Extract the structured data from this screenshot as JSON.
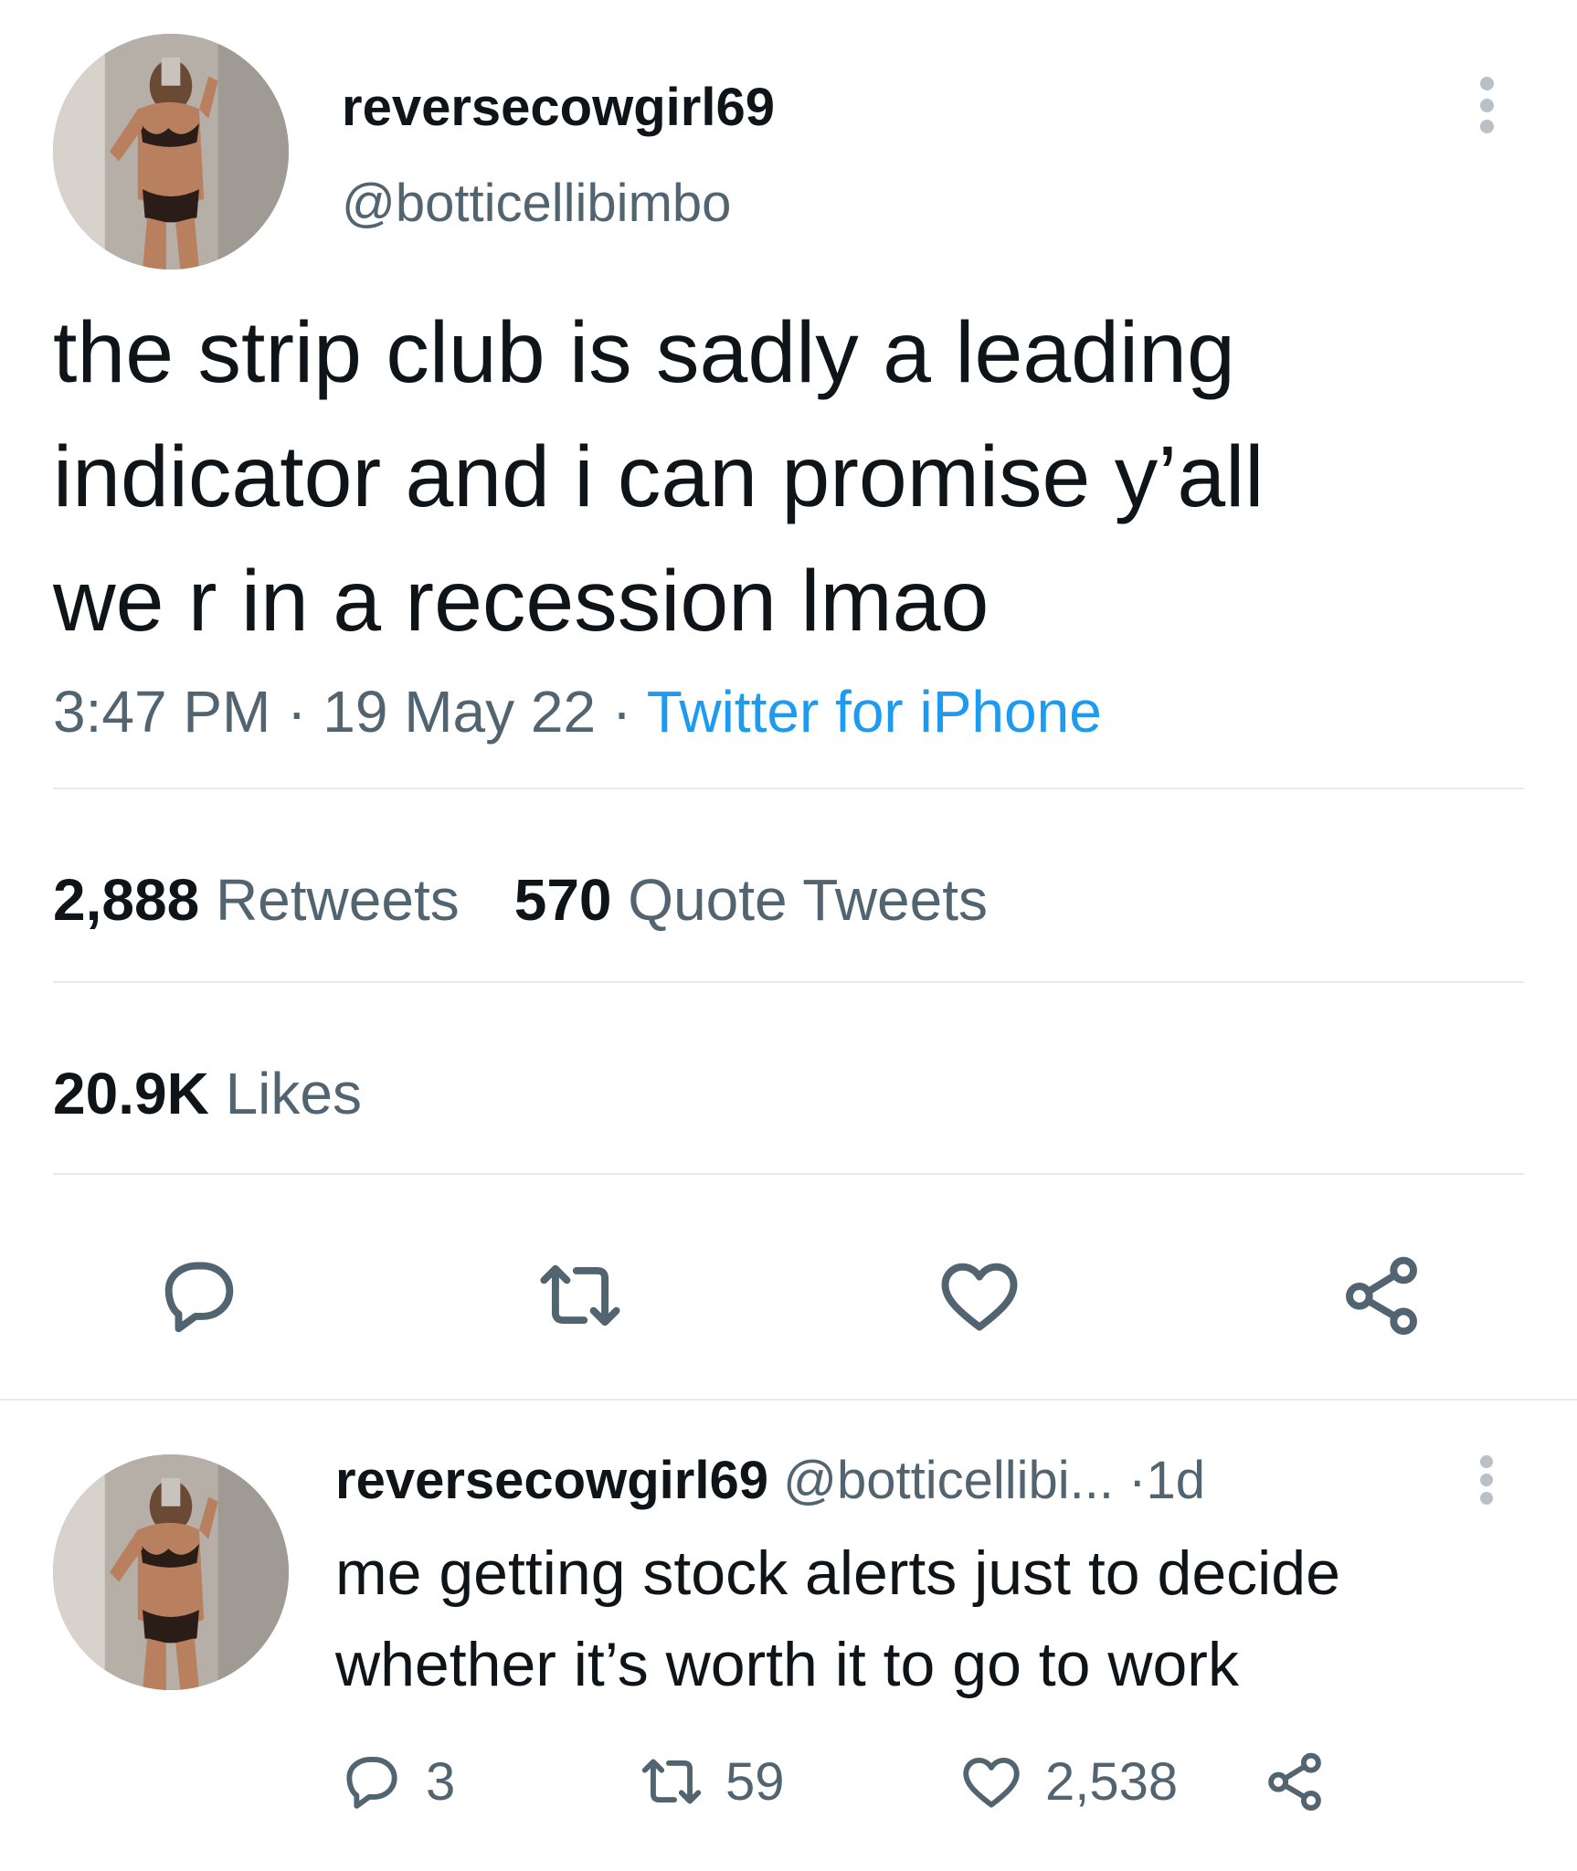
{
  "tweet": {
    "display_name": "reversecowgirl69",
    "handle": "@botticellibimbo",
    "text": "the strip club is sadly a leading\nindicator and i can promise y’all\nwe r in a recession lmao",
    "time": "3:47 PM",
    "separator": "·",
    "date": "19 May 22",
    "source": "Twitter for iPhone",
    "retweets_count": "2,888",
    "retweets_label": "Retweets",
    "quote_count": "570",
    "quote_label": "Quote Tweets",
    "likes_count": "20.9K",
    "likes_label": "Likes",
    "actions": {
      "reply_icon": "reply-icon",
      "retweet_icon": "retweet-icon",
      "like_icon": "heart-icon",
      "share_icon": "share-icon"
    }
  },
  "reply": {
    "display_name": "reversecowgirl69",
    "handle": "@botticellibi...",
    "separator": "·",
    "age": "1d",
    "text": "me getting stock alerts just to decide whether it’s worth it to go to work",
    "reply_count": "3",
    "retweet_count": "59",
    "like_count": "2,538"
  },
  "colors": {
    "text_primary": "#0f1419",
    "text_secondary": "#536471",
    "link": "#1d9bf0",
    "divider": "#e6eaed",
    "icon": "#536471"
  }
}
